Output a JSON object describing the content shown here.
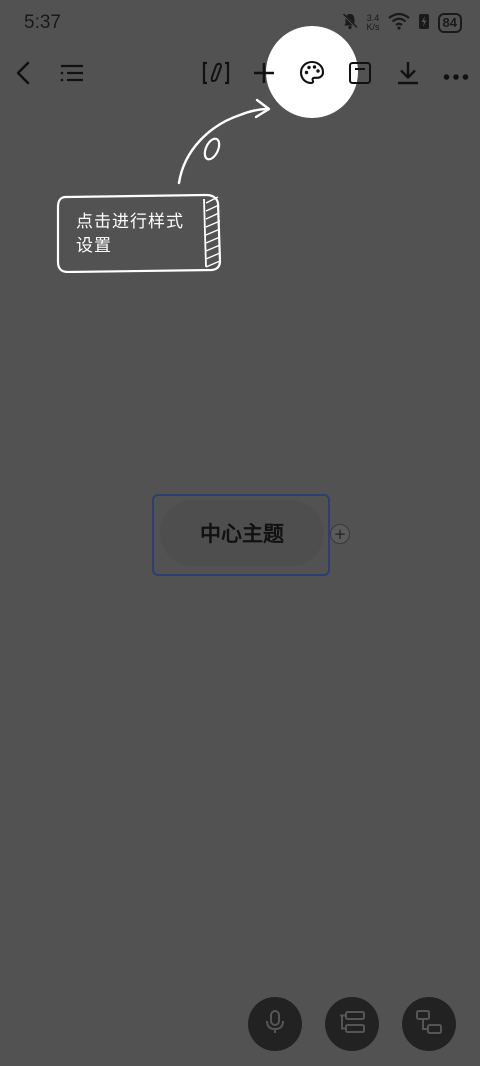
{
  "status_bar": {
    "time": "5:37",
    "net_speed_value": "3.4",
    "net_speed_unit": "K/s",
    "battery": "84"
  },
  "toolbar": {
    "icons": [
      "back-icon",
      "outline-icon",
      "format-brush-icon",
      "add-icon",
      "palette-icon",
      "save-icon",
      "download-icon",
      "more-icon"
    ]
  },
  "tip": {
    "line1": "点击进行样式",
    "line2": "设置"
  },
  "mindmap": {
    "central_topic": "中心主题",
    "add_symbol": "+"
  },
  "bottom_bar": {
    "icons": [
      "microphone-icon",
      "layout-icon",
      "structure-icon"
    ]
  },
  "colors": {
    "overlay_bg": "#525252",
    "highlight": "#ffffff",
    "topic_border": "#2d3e70",
    "fab_bg": "#222222"
  }
}
